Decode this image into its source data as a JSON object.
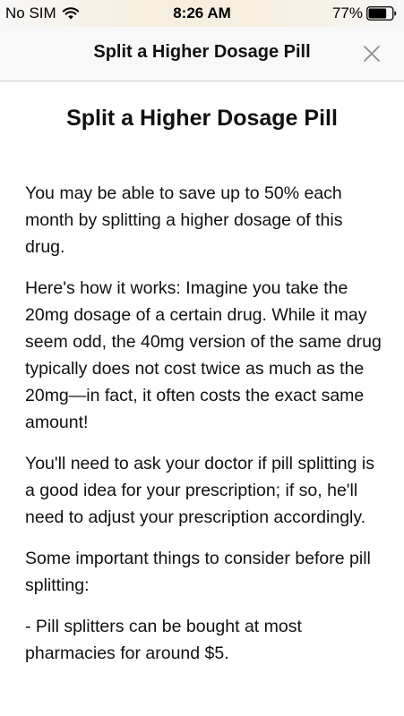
{
  "status_bar": {
    "carrier": "No SIM",
    "time": "8:26 AM",
    "battery_percent": "77%",
    "battery_level": 0.77,
    "wifi_icon": "wifi-icon",
    "battery_icon": "battery-icon"
  },
  "nav": {
    "title": "Split a Higher Dosage Pill",
    "close_icon": "close-icon"
  },
  "article": {
    "heading": "Split a Higher Dosage Pill",
    "paragraphs": [
      "You may be able to save up to 50% each month by splitting a higher dosage of this drug.",
      "Here's how it works: Imagine you take the 20mg dosage of a certain drug. While it may seem odd, the 40mg version of the same drug typically does not cost twice as much as the 20mg—in fact, it often costs the exact same amount!",
      "You'll need to ask your doctor if pill splitting is a good idea for your prescription; if so, he'll need to adjust your prescription accordingly.",
      "Some important things to consider before pill splitting:",
      "- Pill splitters can be bought at most pharmacies for around $5."
    ]
  },
  "colors": {
    "status_bar_tint": "#f6efe0",
    "nav_background": "#f8f8f8",
    "text": "#111111",
    "close_icon": "#8e8e93"
  }
}
